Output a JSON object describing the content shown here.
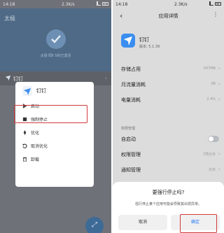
{
  "left": {
    "status": {
      "time": "14:18",
      "speed": "2.3K/s"
    },
    "app_title": "太极",
    "subtitle": "太极·阳Ⅱ 5的已激活",
    "app_row": {
      "name": "钉钉"
    },
    "menu": {
      "app_name": "钉钉",
      "items": [
        {
          "label": "启动",
          "icon": "play-icon"
        },
        {
          "label": "强制停止",
          "icon": "stop-icon"
        },
        {
          "label": "优化",
          "icon": "rocket-icon"
        },
        {
          "label": "取消优化",
          "icon": "undo-icon"
        },
        {
          "label": "卸载",
          "icon": "trash-icon"
        }
      ]
    },
    "fab_icon": "expand-icon"
  },
  "right": {
    "status": {
      "time": "14:18",
      "speed": "2.3K/s"
    },
    "title": "应用详情",
    "app": {
      "name": "钉钉",
      "version": "版本: 5.1.39"
    },
    "items": [
      {
        "label": "存储占用",
        "value": "547MB"
      },
      {
        "label": "月流量消耗",
        "value": "0B"
      },
      {
        "label": "电量消耗",
        "value": "2.4%"
      },
      {
        "label": "自启动",
        "value": ""
      },
      {
        "label": "权限管理",
        "value": "7项允许"
      },
      {
        "label": "通知管理",
        "value": "允许"
      }
    ],
    "section_label": "权限管理",
    "dialog": {
      "title": "要强行停止吗?",
      "message": "强行停止某个应用可能会导致其出现异常。",
      "cancel": "取消",
      "confirm": "确定"
    }
  },
  "colors": {
    "left_header": "#4f6a86",
    "accent_blue": "#2b7cf6",
    "highlight_red": "#d23b3b"
  }
}
